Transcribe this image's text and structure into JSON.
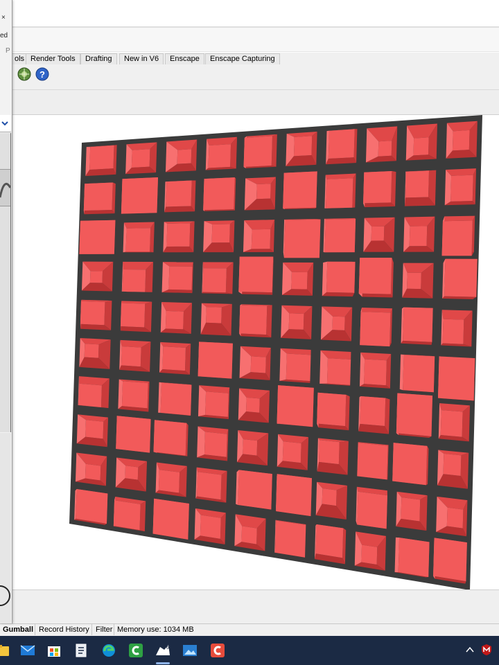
{
  "tabs": [
    {
      "label": "ols"
    },
    {
      "label": "Render Tools"
    },
    {
      "label": "Drafting"
    },
    {
      "label": "New in V6"
    },
    {
      "label": "Enscape"
    },
    {
      "label": "Enscape Capturing"
    }
  ],
  "toolbar": {
    "icons": [
      "globe-render-icon",
      "help-icon"
    ]
  },
  "left_window": {
    "close_glyph": "×",
    "fragment_1": "ed",
    "fragment_2": "P"
  },
  "viewport": {
    "object": "extruded pyramid panel grid",
    "panel_color": "#f25a5a",
    "rows": 10,
    "cols": 10
  },
  "status": {
    "gumball": "Gumball",
    "record_history": "Record History",
    "filter": "Filter",
    "memory": "Memory use: 1034 MB"
  },
  "taskbar": {
    "icons": [
      "folder-icon",
      "mail-icon",
      "store-icon",
      "notepad-icon",
      "edge-icon",
      "camtasia-green-icon",
      "rhino-icon",
      "photos-icon",
      "camtasia-red-icon"
    ],
    "tray": [
      "chevron-up-icon",
      "mcafee-icon"
    ],
    "colors": {
      "bar": "#1b2a44",
      "panel_red": "#f25a5a"
    }
  }
}
